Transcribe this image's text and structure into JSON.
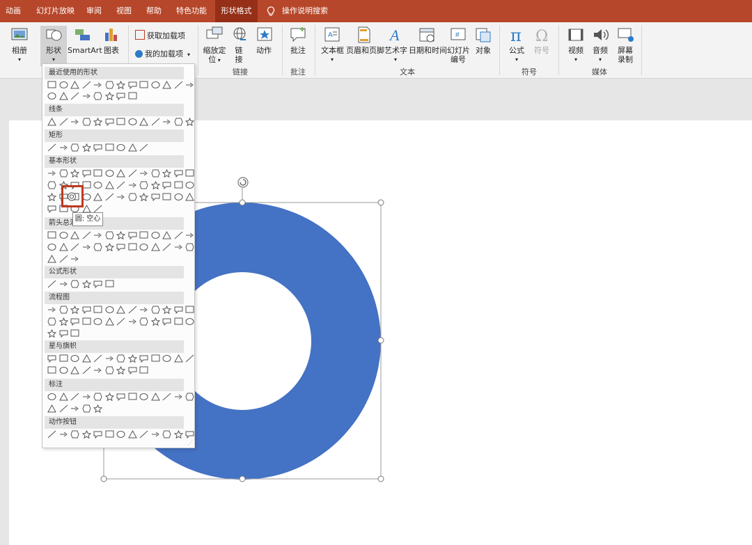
{
  "tabs": [
    {
      "label": "动画",
      "active": false
    },
    {
      "label": "幻灯片放映",
      "active": false
    },
    {
      "label": "审阅",
      "active": false
    },
    {
      "label": "视图",
      "active": false
    },
    {
      "label": "帮助",
      "active": false
    },
    {
      "label": "特色功能",
      "active": false
    },
    {
      "label": "形状格式",
      "active": true
    }
  ],
  "search_label": "操作说明搜索",
  "ribbon": {
    "album": "相册",
    "shapes": "形状",
    "smartart": "SmartArt",
    "chart": "图表",
    "get_addins": "获取加载项",
    "my_addins": "我的加载项",
    "zoom_line1": "缩放定",
    "zoom_line2": "位",
    "link_line1": "链",
    "link_line2": "接",
    "action": "动作",
    "comment": "批注",
    "textbox": "文本框",
    "header_footer": "页眉和页脚",
    "wordart": "艺术字",
    "datetime": "日期和时间",
    "slide_num_line1": "幻灯片",
    "slide_num_line2": "编号",
    "object": "对象",
    "equation": "公式",
    "symbol": "符号",
    "video": "视频",
    "audio": "音频",
    "screen_line1": "屏幕",
    "screen_line2": "录制",
    "group_links": "链接",
    "group_comments": "批注",
    "group_text": "文本",
    "group_symbols": "符号",
    "group_media": "媒体"
  },
  "dropdown": {
    "sections": [
      "最近使用的形状",
      "线条",
      "矩形",
      "基本形状",
      "箭头总汇",
      "公式形状",
      "流程图",
      "星与旗帜",
      "标注",
      "动作按钮"
    ],
    "tooltip": "圆: 空心"
  },
  "colors": {
    "accent": "#b7472a",
    "active_tab": "#962f18",
    "donut": "#4472c4",
    "highlight": "#c0391f"
  }
}
